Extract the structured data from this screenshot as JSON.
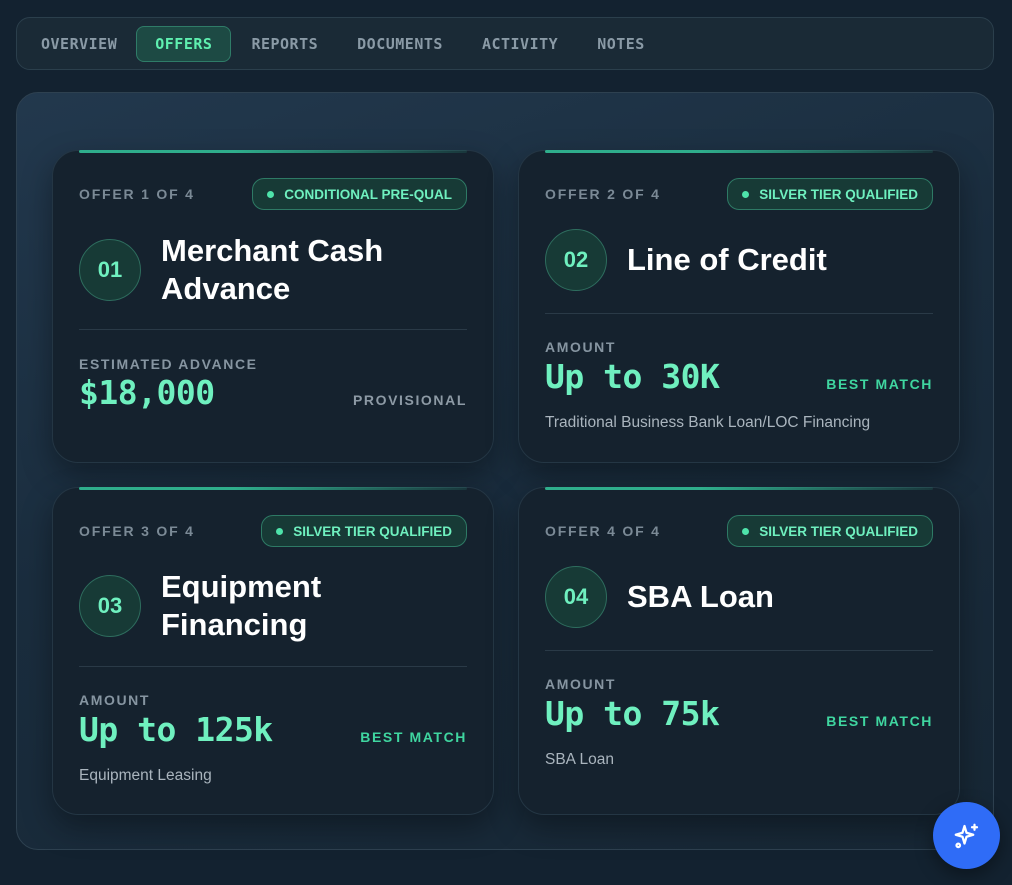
{
  "tabs": [
    {
      "label": "OVERVIEW",
      "active": false
    },
    {
      "label": "OFFERS",
      "active": true
    },
    {
      "label": "REPORTS",
      "active": false
    },
    {
      "label": "DOCUMENTS",
      "active": false
    },
    {
      "label": "ACTIVITY",
      "active": false
    },
    {
      "label": "NOTES",
      "active": false
    }
  ],
  "offers": [
    {
      "count": "OFFER 1 OF 4",
      "badge": "CONDITIONAL PRE-QUAL",
      "number": "01",
      "title": "Merchant Cash Advance",
      "amount_label": "ESTIMATED ADVANCE",
      "amount": "$18,000",
      "tag": "PROVISIONAL",
      "description": ""
    },
    {
      "count": "OFFER 2 OF 4",
      "badge": "SILVER TIER QUALIFIED",
      "number": "02",
      "title": "Line of Credit",
      "amount_label": "AMOUNT",
      "amount": "Up to 30K",
      "tag": "BEST MATCH",
      "description": "Traditional Business Bank Loan/LOC Financing"
    },
    {
      "count": "OFFER 3 OF 4",
      "badge": "SILVER TIER QUALIFIED",
      "number": "03",
      "title": "Equipment Financing",
      "amount_label": "AMOUNT",
      "amount": "Up to 125k",
      "tag": "BEST MATCH",
      "description": "Equipment Leasing"
    },
    {
      "count": "OFFER 4 OF 4",
      "badge": "SILVER TIER QUALIFIED",
      "number": "04",
      "title": "SBA Loan",
      "amount_label": "AMOUNT",
      "amount": "Up to 75k",
      "tag": "BEST MATCH",
      "description": "SBA Loan"
    }
  ],
  "colors": {
    "accent": "#6ff0bf",
    "background": "#132230",
    "card": "#15222e",
    "fab": "#2f6cf7"
  },
  "fab": {
    "icon": "sparkles-icon"
  }
}
